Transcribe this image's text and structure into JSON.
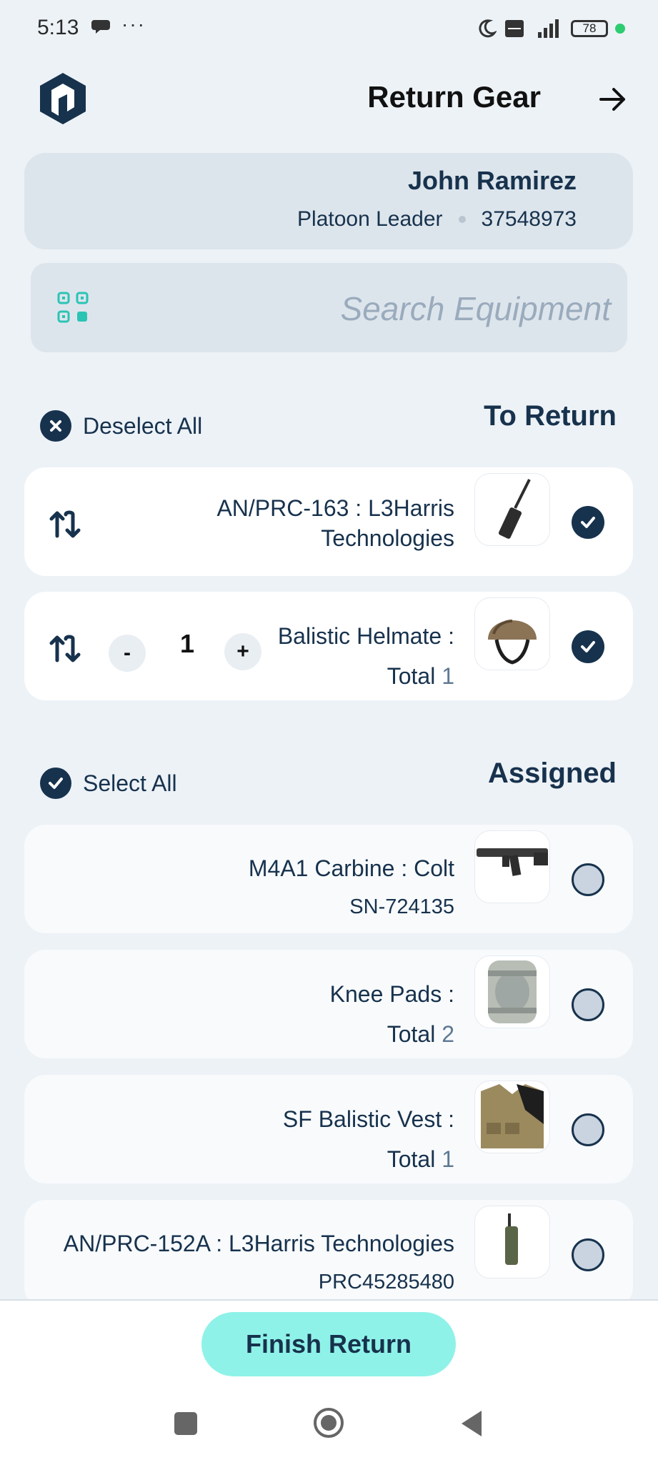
{
  "status_bar": {
    "time": "5:13",
    "dots": "···",
    "battery": "78"
  },
  "header": {
    "title": "Return Gear"
  },
  "profile": {
    "name": "John Ramirez",
    "role": "Platoon Leader",
    "id": "37548973"
  },
  "search": {
    "placeholder": "Search Equipment"
  },
  "to_return": {
    "title": "To Return",
    "toggle_label": "Deselect All",
    "items": [
      {
        "name_line1": "AN/PRC-163 : L3Harris",
        "name_line2": "Technologies",
        "checked": true
      },
      {
        "name_line1": "Balistic Helmate :",
        "total_label": "Total",
        "total": "1",
        "quantity": "1",
        "minus": "-",
        "plus": "+",
        "checked": true
      }
    ]
  },
  "assigned": {
    "title": "Assigned",
    "toggle_label": "Select All",
    "items": [
      {
        "name": "M4A1 Carbine : Colt",
        "sub": "SN-724135",
        "checked": false
      },
      {
        "name": "Knee Pads :",
        "total_label": "Total",
        "total": "2",
        "checked": false
      },
      {
        "name": "SF Balistic Vest :",
        "total_label": "Total",
        "total": "1",
        "checked": false
      },
      {
        "name": "AN/PRC-152A : L3Harris Technologies",
        "sub": "PRC45285480",
        "checked": false
      }
    ]
  },
  "footer": {
    "finish_label": "Finish Return"
  },
  "colors": {
    "primary": "#17324d",
    "accent": "#8ff2e8",
    "background": "#edf2f7",
    "scan_icon": "#2bc4b4"
  }
}
